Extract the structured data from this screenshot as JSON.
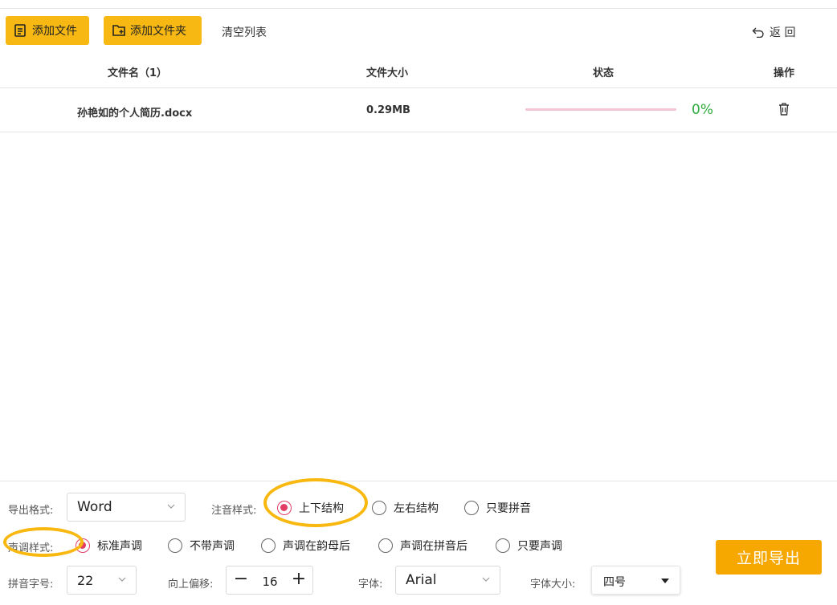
{
  "toolbar": {
    "add_file": "添加文件",
    "add_folder": "添加文件夹",
    "clear_list": "清空列表",
    "back": "返 回"
  },
  "table": {
    "headers": {
      "filename": "文件名（1）",
      "filesize": "文件大小",
      "status": "状态",
      "action": "操作"
    },
    "rows": [
      {
        "filename": "孙艳如的个人简历.docx",
        "filesize": "0.29MB",
        "progress_pct": 0,
        "progress_text": "0%"
      }
    ]
  },
  "settings": {
    "export_format": {
      "label": "导出格式:",
      "value": "Word"
    },
    "annotation_style": {
      "label": "注音样式:",
      "options": [
        "上下结构",
        "左右结构",
        "只要拼音"
      ],
      "selected": 0
    },
    "tone_style": {
      "label": "声调样式:",
      "options": [
        "标准声调",
        "不带声调",
        "声调在韵母后",
        "声调在拼音后",
        "只要声调"
      ],
      "selected": 0
    },
    "pinyin_size": {
      "label": "拼音字号:",
      "value": "22"
    },
    "offset": {
      "label": "向上偏移:",
      "value": "16",
      "minus": "−",
      "plus": "+"
    },
    "font": {
      "label": "字体:",
      "value": "Arial"
    },
    "font_size": {
      "label": "字体大小:",
      "value": "四号"
    },
    "export_button": "立即导出"
  },
  "colors": {
    "accent_yellow": "#f7b813",
    "export_orange": "#f7a800",
    "radio_selected": "#e23b64",
    "progress_track": "#f4c5d2",
    "percent_green": "#2eaa3e",
    "highlight_ring": "#f9b810"
  }
}
